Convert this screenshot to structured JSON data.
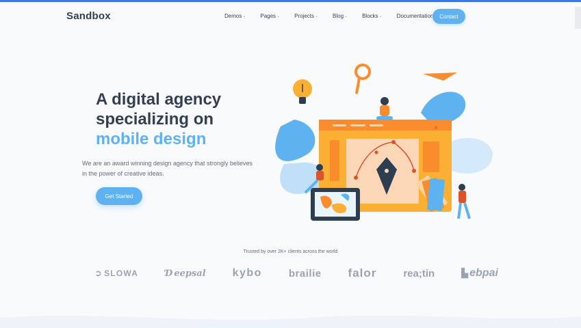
{
  "header": {
    "logo": "Sandbox",
    "nav": [
      "Demos",
      "Pages",
      "Projects",
      "Blog",
      "Blocks",
      "Documentation"
    ],
    "contact_label": "Contact"
  },
  "hero": {
    "title_line1": "A digital agency",
    "title_line2": "specializing on",
    "title_accent": "mobile design",
    "description": "We are an award winning design agency that strongly believes in the power of creative ideas.",
    "cta_label": "Get Started"
  },
  "clients": {
    "caption": "Trusted by over 2K+ clients across the world",
    "logos": [
      "SLOWA",
      "eepsal",
      "kybo",
      "brailie",
      "falor",
      "rea;tin",
      "ebpai"
    ]
  },
  "colors": {
    "accent": "#5eb2f0",
    "text": "#343f52",
    "orange": "#fb8c2e",
    "navy": "#2d3e50"
  },
  "icons": [
    "chevron-down-icon",
    "lightbulb-icon",
    "magnifier-icon",
    "paper-plane-icon",
    "pen-tool-icon",
    "close-icon"
  ]
}
